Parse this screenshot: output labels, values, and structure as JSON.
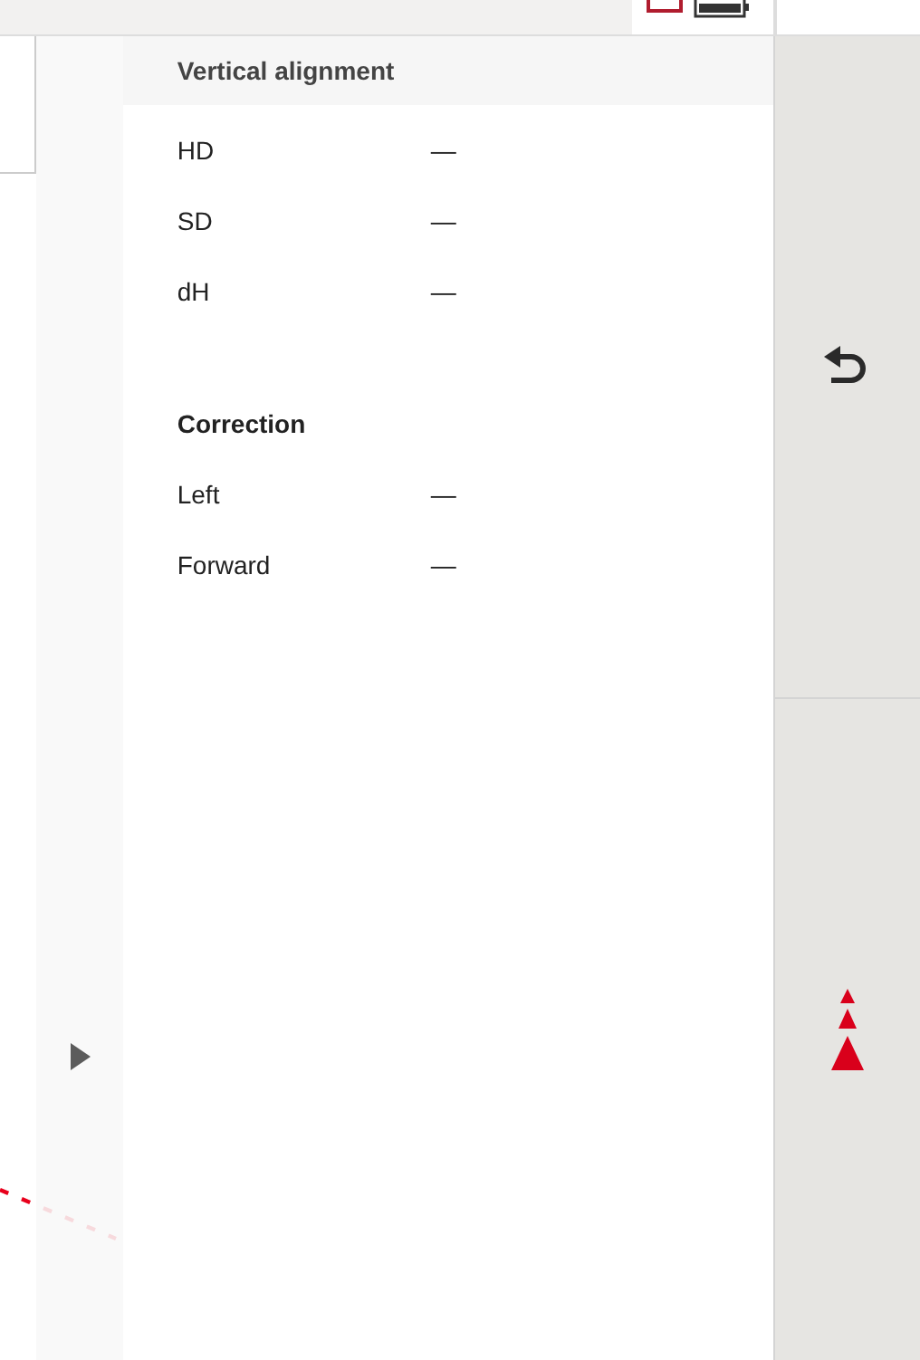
{
  "panel": {
    "title": "Vertical alignment",
    "sections": [
      {
        "rows": [
          {
            "label": "HD",
            "value": "—"
          },
          {
            "label": "SD",
            "value": "—"
          },
          {
            "label": "dH",
            "value": "—"
          }
        ]
      },
      {
        "title": "Correction",
        "rows": [
          {
            "label": "Left",
            "value": "—"
          },
          {
            "label": "Forward",
            "value": "—"
          }
        ]
      }
    ]
  }
}
